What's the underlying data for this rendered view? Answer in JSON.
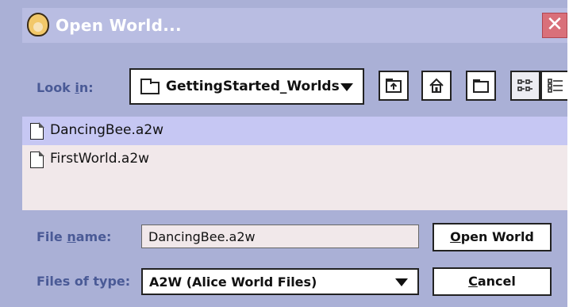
{
  "window": {
    "title": "Open World...",
    "close_label": "✕"
  },
  "lookin": {
    "label_pre": "Look ",
    "label_mn": "i",
    "label_post": "n:",
    "value": "GettingStarted_Worlds"
  },
  "toolbar": {
    "buttons": [
      "up-one-level",
      "home",
      "new-folder",
      "list-view",
      "details-view"
    ]
  },
  "files": [
    {
      "name": "DancingBee.a2w",
      "selected": true
    },
    {
      "name": "FirstWorld.a2w",
      "selected": false
    }
  ],
  "filename": {
    "label_pre": "File ",
    "label_mn": "n",
    "label_post": "ame:",
    "value": "DancingBee.a2w"
  },
  "filetype": {
    "label": "Files of type:",
    "value": "A2W (Alice World Files)"
  },
  "buttons": {
    "open_mn": "O",
    "open_rest": "pen World",
    "cancel_mn": "C",
    "cancel_rest": "ancel"
  },
  "colors": {
    "panel": "#aab0d6",
    "list_bg": "#f1e8ea",
    "selection": "#c6c7f3",
    "label_text": "#4a5a96"
  }
}
